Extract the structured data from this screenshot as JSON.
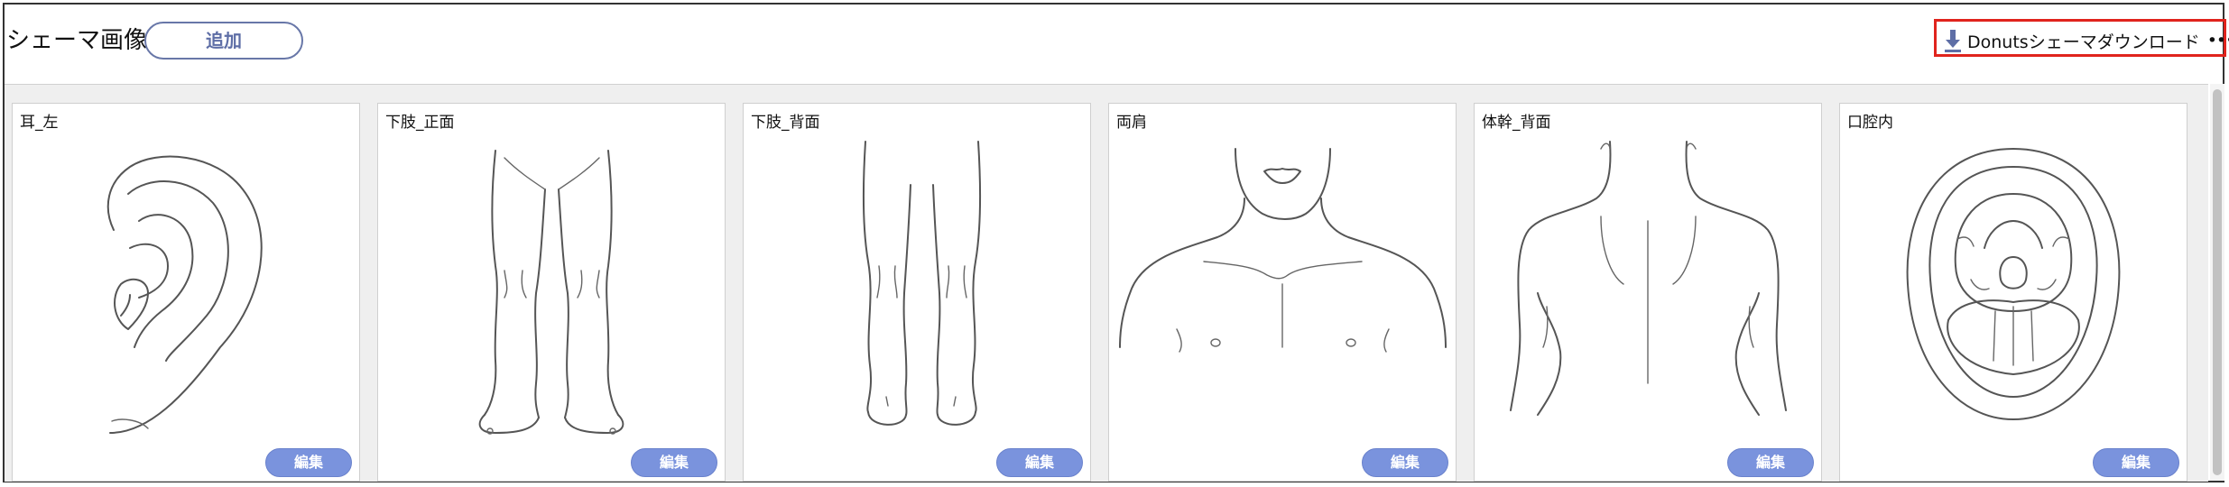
{
  "header": {
    "title": "シェーマ画像",
    "add_label": "追加",
    "download_label": "Donutsシェーマダウンロード",
    "more_label": "•••"
  },
  "cards": [
    {
      "label": "耳_左",
      "edit_label": "編集",
      "icon": "ear-left-icon"
    },
    {
      "label": "下肢_正面",
      "edit_label": "編集",
      "icon": "legs-front-icon"
    },
    {
      "label": "下肢_背面",
      "edit_label": "編集",
      "icon": "legs-back-icon"
    },
    {
      "label": "両肩",
      "edit_label": "編集",
      "icon": "shoulders-icon"
    },
    {
      "label": "体幹_背面",
      "edit_label": "編集",
      "icon": "trunk-back-icon"
    },
    {
      "label": "口腔内",
      "edit_label": "編集",
      "icon": "oral-cavity-icon"
    }
  ],
  "colors": {
    "accent": "#7a93dd",
    "add_border": "#6877a8",
    "highlight_border": "#e0241d",
    "download_icon": "#5e6ea6"
  }
}
